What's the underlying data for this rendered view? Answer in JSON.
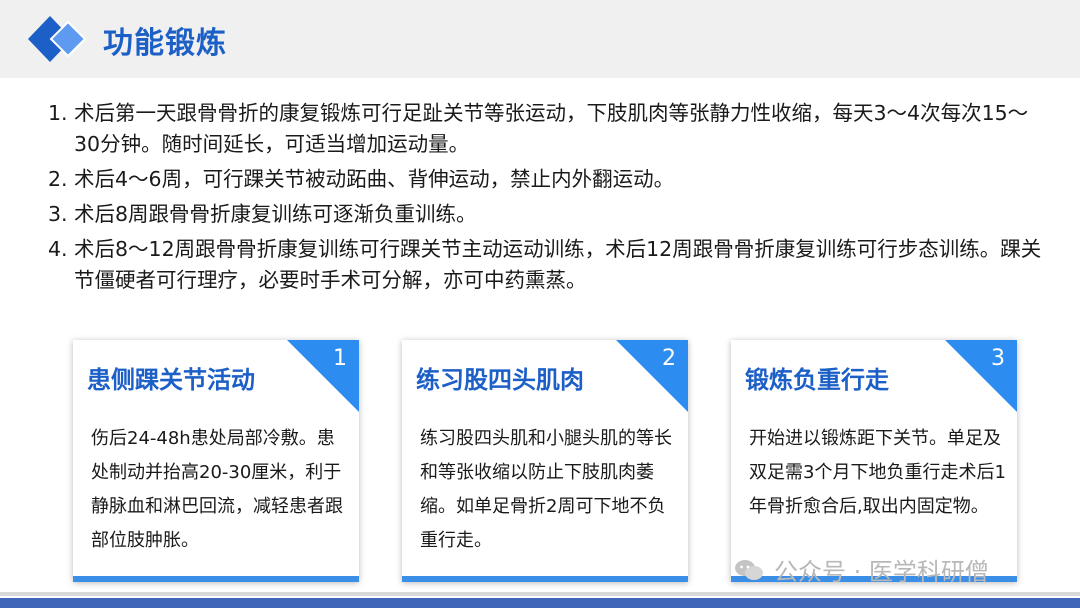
{
  "header": {
    "title": "功能锻炼"
  },
  "points": [
    {
      "num": "1.",
      "text": "术后第一天跟骨骨折的康复锻炼可行足趾关节等张运动，下肢肌肉等张静力性收缩，每天3～4次每次15～30分钟。随时间延长，可适当增加运动量。"
    },
    {
      "num": "2.",
      "text": "术后4～6周，可行踝关节被动跖曲、背伸运动，禁止内外翻运动。"
    },
    {
      "num": "3.",
      "text": "术后8周跟骨骨折康复训练可逐渐负重训练。"
    },
    {
      "num": "4.",
      "text": "术后8～12周跟骨骨折康复训练可行踝关节主动运动训练，术后12周跟骨骨折康复训练可行步态训练。踝关节僵硬者可行理疗，必要时手术可分解，亦可中药熏蒸。"
    }
  ],
  "cards": [
    {
      "number": "1",
      "title": "患侧踝关节活动",
      "body": "伤后24-48h患处局部冷敷。患处制动并抬高20-30厘米，利于静脉血和淋巴回流，减轻患者跟部位肢肿胀。"
    },
    {
      "number": "2",
      "title": "练习股四头肌肉",
      "body": "练习股四头肌和小腿头肌的等长和等张收缩以防止下肢肌肉萎缩。如单足骨折2周可下地不负重行走。"
    },
    {
      "number": "3",
      "title": "锻炼负重行走",
      "body": "开始进以锻炼距下关节。单足及双足需3个月下地负重行走术后1年骨折愈合后,取出内固定物。"
    }
  ],
  "watermark": {
    "text": "公众号 · 医学科研僧",
    "icon": "wechat-icon"
  },
  "colors": {
    "accent": "#1c5fc7",
    "corner": "#2d8cf0",
    "footer": "#3f66b8"
  }
}
